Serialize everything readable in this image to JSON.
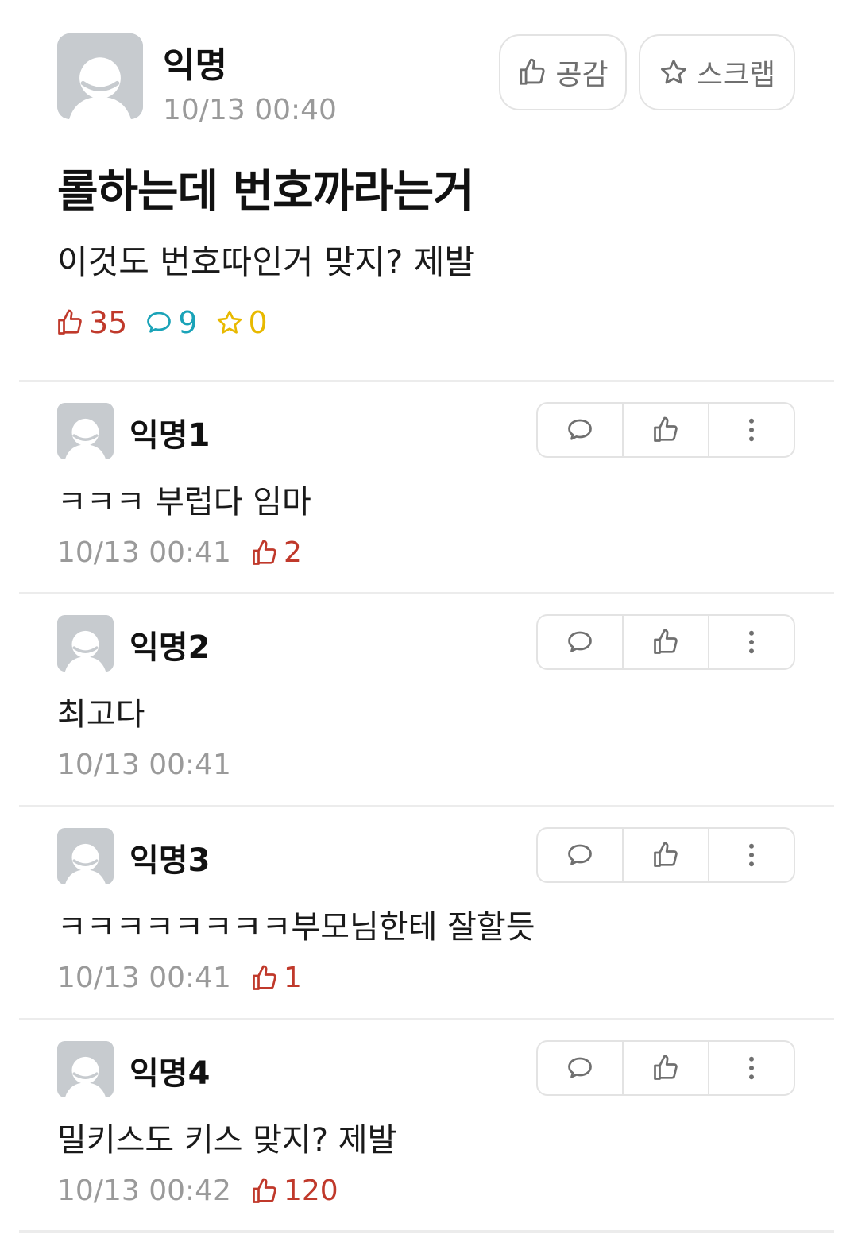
{
  "post": {
    "author": "익명",
    "time": "10/13 00:40",
    "like_button_label": "공감",
    "scrap_button_label": "스크랩",
    "title": "롤하는데 번호까라는거",
    "body": "이것도 번호따인거 맞지? 제발",
    "stats": {
      "likes": "35",
      "comments": "9",
      "scraps": "0"
    }
  },
  "comments": [
    {
      "author": "익명1",
      "text": "ㅋㅋㅋ 부럽다 임마",
      "time": "10/13 00:41",
      "likes": "2"
    },
    {
      "author": "익명2",
      "text": "최고다",
      "time": "10/13 00:41",
      "likes": ""
    },
    {
      "author": "익명3",
      "text": "ㅋㅋㅋㅋㅋㅋㅋㅋ부모님한테 잘할듯",
      "time": "10/13 00:41",
      "likes": "1"
    },
    {
      "author": "익명4",
      "text": "밀키스도 키스 맞지? 제발",
      "time": "10/13 00:42",
      "likes": "120"
    }
  ],
  "colors": {
    "like_accent": "#c0392b",
    "comment_accent": "#1aa3b8",
    "scrap_accent": "#e8b900",
    "muted_text": "#9a9a9a",
    "avatar_bg": "#c7cbcf"
  },
  "icons": {
    "avatar": "default-user-avatar",
    "like": "thumbs-up-icon",
    "scrap": "star-icon",
    "comment": "speech-bubble-icon",
    "more": "vertical-dots-icon"
  }
}
